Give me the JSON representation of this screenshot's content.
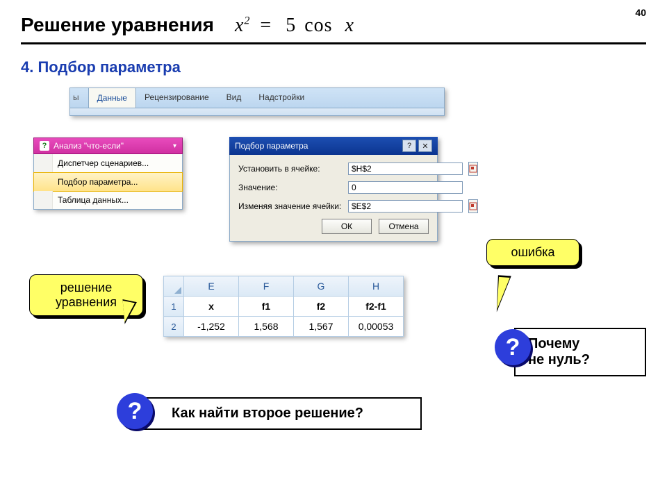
{
  "page_number": "40",
  "title": "Решение уравнения",
  "equation": {
    "lhs_var": "x",
    "lhs_exp": "2",
    "eq": "=",
    "rhs_coef": "5",
    "rhs_fn": "cos",
    "rhs_arg": "x"
  },
  "subtitle": "4. Подбор параметра",
  "ribbon": {
    "partial_tab": "ы",
    "tabs": [
      "Данные",
      "Рецензирование",
      "Вид",
      "Надстройки"
    ],
    "active_index": 0
  },
  "whatif": {
    "header_icon": "?",
    "header": "Анализ \"что-если\"",
    "items": [
      {
        "label": "Диспетчер сценариев...",
        "accel": "Д"
      },
      {
        "label": "Подбор параметра...",
        "accel": "П",
        "selected": true
      },
      {
        "label": "Таблица данных...",
        "accel": "Т"
      }
    ]
  },
  "dialog": {
    "title": "Подбор параметра",
    "rows": [
      {
        "label": "Установить в ячейке:",
        "value": "$H$2",
        "refpick": true
      },
      {
        "label": "Значение:",
        "value": "0",
        "refpick": false
      },
      {
        "label": "Изменяя значение ячейки:",
        "value": "$E$2",
        "refpick": true
      }
    ],
    "ok": "ОК",
    "cancel": "Отмена"
  },
  "callouts": {
    "solution": "решение уравнения",
    "error": "ошибка"
  },
  "grid": {
    "cols": [
      "E",
      "F",
      "G",
      "H"
    ],
    "row_labels": [
      "1",
      "2"
    ],
    "headers": [
      "x",
      "f1",
      "f2",
      "f2-f1"
    ],
    "values": [
      "-1,252",
      "1,568",
      "1,567",
      "0,00053"
    ]
  },
  "questions": {
    "q1": "Почему не нуль?",
    "q2": "Как найти второе решение?",
    "mark": "?"
  }
}
